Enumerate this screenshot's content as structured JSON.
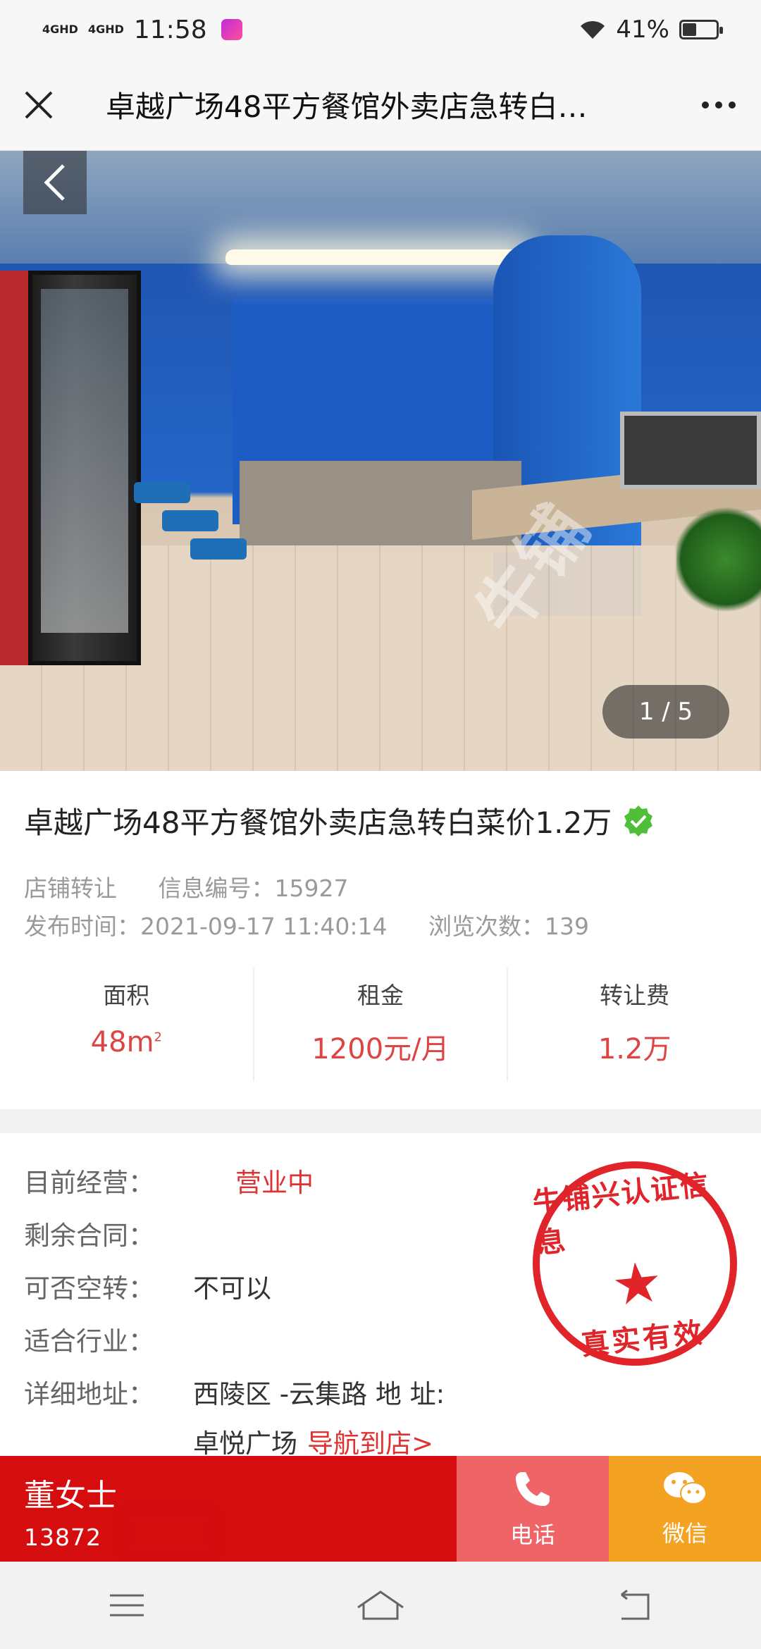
{
  "status_bar": {
    "net1": "4GHD",
    "net2": "4GHD",
    "time": "11:58",
    "battery": "41%",
    "battery_level": 0.41
  },
  "navbar": {
    "title": "卓越广场48平方餐馆外卖店急转白…"
  },
  "hero": {
    "watermark": "牛铺",
    "counter": "1 / 5"
  },
  "listing": {
    "title": "卓越广场48平方餐馆外卖店急转白菜价1.2万",
    "category": "店铺转让",
    "info_id": "信息编号：15927",
    "publish_time": "发布时间：2021-09-17 11:40:14",
    "views": "浏览次数：139",
    "stats": {
      "area_label": "面积",
      "area_value": "48m",
      "area_unit_sup": "2",
      "rent_label": "租金",
      "rent_value": "1200元/月",
      "fee_label": "转让费",
      "fee_value": "1.2万"
    }
  },
  "details": {
    "current_label": "目前经营：",
    "current_value": "营业中",
    "contract_label": "剩余合同：",
    "contract_value": "",
    "empty_transfer_label": "可否空转：",
    "empty_transfer_value": "不可以",
    "industry_label": "适合行业：",
    "industry_value": "",
    "address_label": "详细地址：",
    "address_line1": "西陵区 -云集路 地 址:",
    "address_line2": "卓悦广场",
    "navigate": "导航到店>",
    "stamp_top": "牛铺兴认证信息",
    "stamp_bottom": "真实有效"
  },
  "contact": {
    "name": "董女士",
    "phone": "13872",
    "call_label": "电话",
    "wechat_label": "微信"
  },
  "colors": {
    "accent_red": "#d50d0f",
    "call_bg": "#ef6466",
    "wechat_bg": "#f3a221",
    "price_red": "#dd4444"
  }
}
